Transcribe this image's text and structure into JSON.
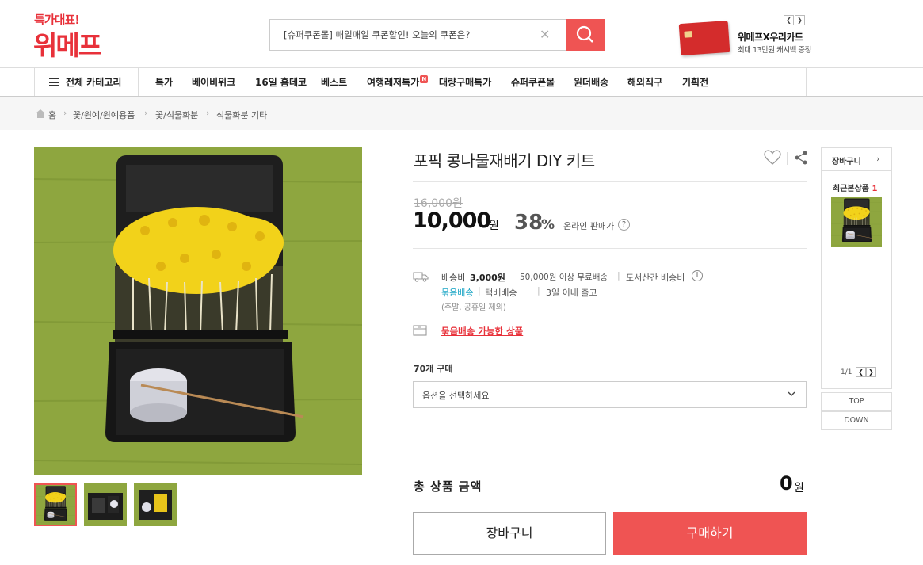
{
  "header": {
    "logo_top": "특가대표!",
    "logo_main": "위메프",
    "search_value": "[슈퍼쿠폰몰] 매일매일 쿠폰할인! 오늘의 쿠폰은?",
    "card_title": "위메프X우리카드",
    "card_sub": "최대 13만원 캐시백 증정",
    "accent": "#e8313a"
  },
  "nav": {
    "all_categories": "전체 카테고리",
    "items": [
      "특가",
      "베이비위크",
      "16일 홈데코",
      "베스트",
      "여행레저특가",
      "대량구매특가",
      "슈퍼쿠폰몰",
      "원더배송",
      "해외직구",
      "기획전"
    ],
    "new_badge": "N"
  },
  "breadcrumb": [
    "홈",
    "꽃/원예/원예용품",
    "꽃/식물화분",
    "식물화분 기타"
  ],
  "product": {
    "title": "포픽 콩나물재배기 DIY 키트",
    "original_price": "16,000원",
    "sale_price": "10,000",
    "won": "원",
    "discount": "38",
    "pct": "%",
    "online_label": "온라인 판매가",
    "shipping_label": "배송비",
    "shipping_fee": "3,000원",
    "free_ship": "50,000원 이상 무료배송",
    "remote_ship": "도서산간 배송비",
    "bundle_ship": "묶음배송",
    "courier": "택배배송",
    "ship_days": "3일 이내 출고",
    "excluded": "(주말, 공휴일 제외)",
    "bundle_link": "묶음배송 가능한 상품",
    "buy_count": "70개 구매",
    "option_placeholder": "옵션을 선택하세요",
    "total_label": "총 상품 금액",
    "total_value": "0",
    "cart_btn": "장바구니",
    "buy_btn": "구매하기"
  },
  "sidebar": {
    "cart": "장바구니",
    "recent_label": "최근본상품",
    "recent_count": "1",
    "pager": "1/1",
    "top": "TOP",
    "down": "DOWN"
  }
}
